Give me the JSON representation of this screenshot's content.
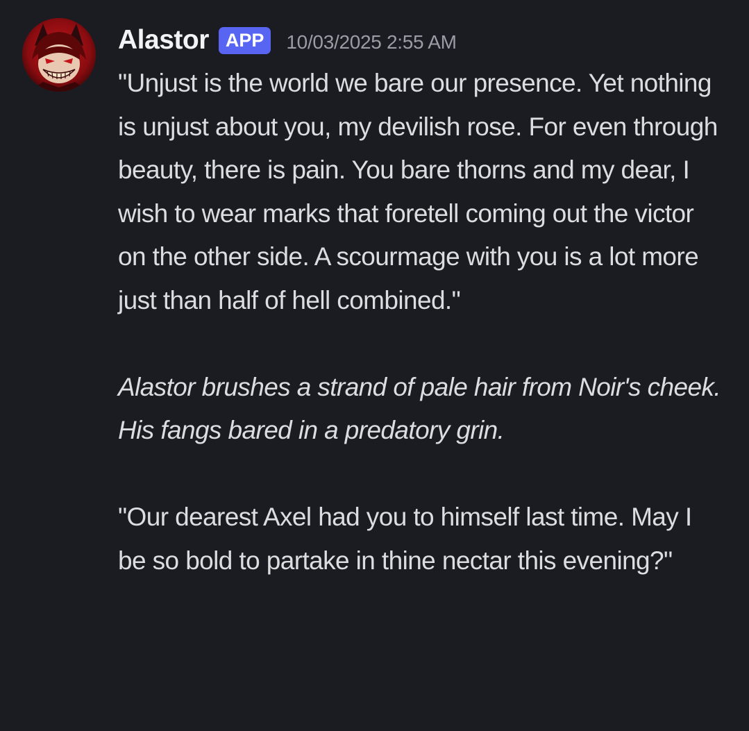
{
  "message": {
    "author": {
      "name": "Alastor",
      "badge": "APP",
      "avatar_icon": "alastor-avatar-icon"
    },
    "timestamp": "10/03/2025 2:55 AM",
    "paragraphs": [
      "\"Unjust is the world we bare our presence. Yet nothing is unjust about you, my devilish rose. For even through beauty, there is pain. You bare thorns and my dear, I wish to wear marks that foretell coming out the victor on the other side. A scourmage with you is a lot more just than half of hell combined.\"",
      "Alastor brushes a strand of pale hair from Noir's cheek. His fangs bared in a predatory grin.",
      "\"Our dearest Axel had you to himself last time. May I be so bold to partake in thine nectar this evening?\""
    ]
  },
  "colors": {
    "background": "#1b1c21",
    "username": "#f2f3f5",
    "badge": "#5865f2",
    "timestamp": "#9a9ca6",
    "text": "#dbdee1"
  }
}
